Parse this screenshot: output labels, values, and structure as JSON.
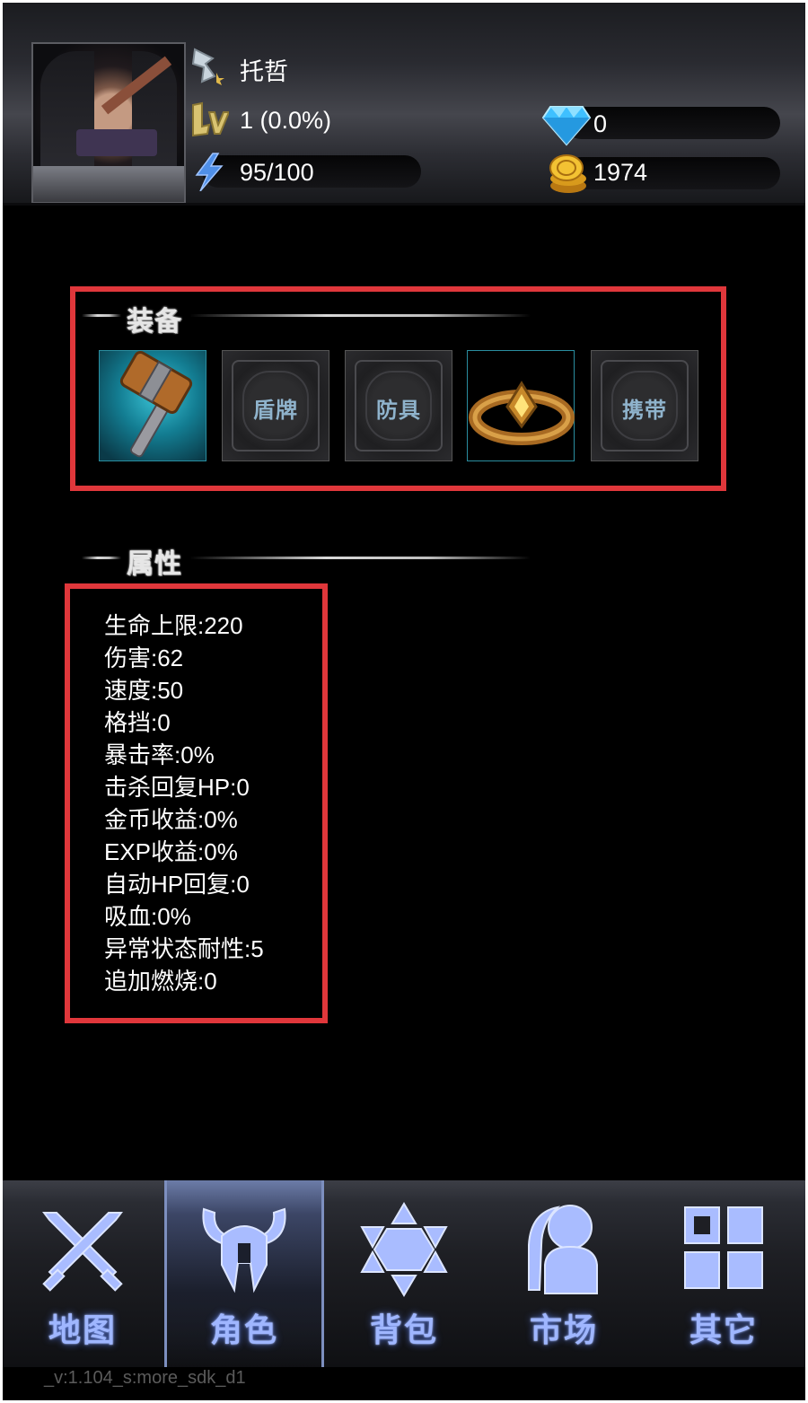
{
  "player": {
    "name": "托哲",
    "level": "1 (0.0%)",
    "energy": "95/100",
    "diamonds": "0",
    "gold": "1974"
  },
  "equipment": {
    "title": "装备",
    "slots": [
      {
        "label": "",
        "item": "hammer"
      },
      {
        "label": "盾牌",
        "item": ""
      },
      {
        "label": "防具",
        "item": ""
      },
      {
        "label": "",
        "item": "ring"
      },
      {
        "label": "携带",
        "item": ""
      }
    ]
  },
  "attributes": {
    "title": "属性",
    "items": [
      "生命上限:220",
      "伤害:62",
      "速度:50",
      "格挡:0",
      "暴击率:0%",
      "击杀回复HP:0",
      "金币收益:0%",
      "EXP收益:0%",
      "自动HP回复:0",
      "吸血:0%",
      "异常状态耐性:5",
      "追加燃烧:0"
    ]
  },
  "nav": {
    "items": [
      {
        "label": "地图",
        "icon": "crossed-swords-icon"
      },
      {
        "label": "角色",
        "icon": "horned-helmet-icon"
      },
      {
        "label": "背包",
        "icon": "star-of-david-icon"
      },
      {
        "label": "市场",
        "icon": "person-icon"
      },
      {
        "label": "其它",
        "icon": "grid-icon"
      }
    ],
    "active_index": 1
  },
  "version": "_v:1.104_s:more_sdk_d1",
  "colors": {
    "highlight_box": "#e0373b",
    "nav_label": "#9fb6ff",
    "nav_active": "#6c7ca8"
  }
}
